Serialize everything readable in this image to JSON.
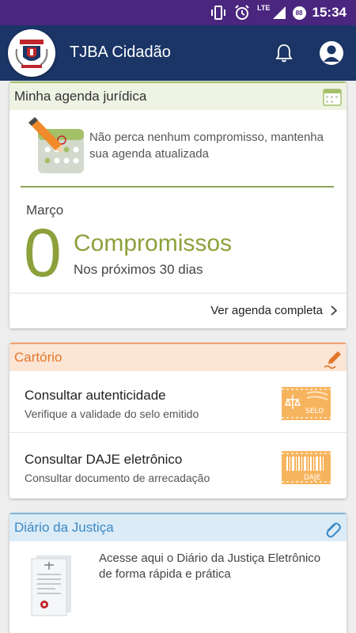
{
  "status_bar": {
    "time": "15:34",
    "network_label": "LTE",
    "badge_value": "88",
    "icons": [
      "vibrate-icon",
      "alarm-icon",
      "lte-signal-icon",
      "badge-icon"
    ]
  },
  "app_bar": {
    "title": "TJBA Cidadão",
    "icons": [
      "court-logo-icon",
      "notification-bell-icon",
      "account-icon"
    ]
  },
  "agenda": {
    "header": "Minha agenda jurídica",
    "promo_text": "Não perca nenhum compromisso, mantenha sua agenda atualizada",
    "month": "Março",
    "count": "0",
    "count_label": "Compromissos",
    "period": "Nos próximos 30 dias",
    "link_text": "Ver agenda completa",
    "accent_color": "#8ca13b"
  },
  "cartorio": {
    "header": "Cartório",
    "accent_color": "#e2772a",
    "items": [
      {
        "title": "Consultar autenticidade",
        "subtitle": "Verifique a validade do selo emitido",
        "badge_text": "SELO"
      },
      {
        "title": "Consultar DAJE eletrônico",
        "subtitle": "Consultar documento de arrecadação",
        "badge_text": "DAJE"
      }
    ]
  },
  "diario": {
    "header": "Diário da Justiça",
    "text": "Acesse aqui o Diário da Justiça Eletrônico de forma rápida e prática",
    "accent_color": "#3a88c4"
  },
  "colors": {
    "status_bar": "#4a267f",
    "app_bar": "#1a3566",
    "background": "#eeeeee"
  }
}
